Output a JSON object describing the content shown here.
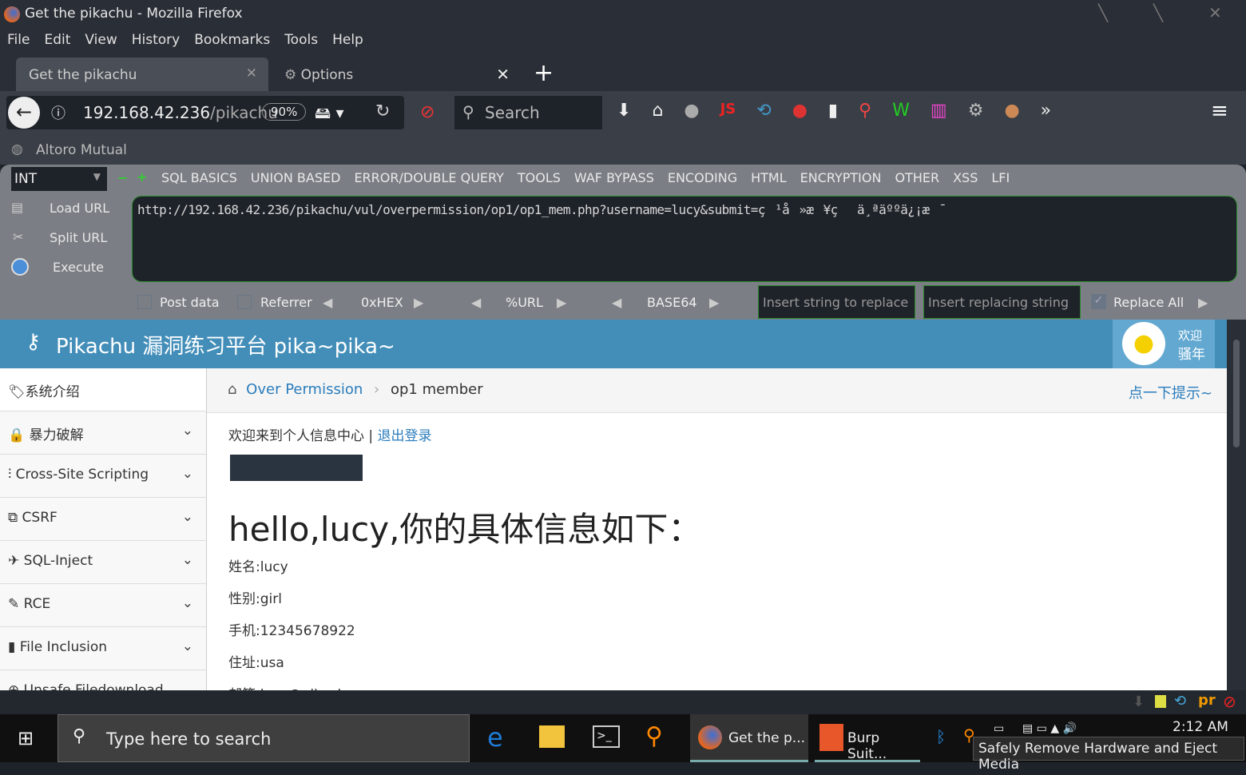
{
  "window": {
    "title": "Get the pikachu - Mozilla Firefox"
  },
  "menu": [
    "File",
    "Edit",
    "View",
    "History",
    "Bookmarks",
    "Tools",
    "Help"
  ],
  "tabs": [
    {
      "label": "Get the pikachu"
    },
    {
      "label": "Options"
    }
  ],
  "navbar": {
    "url_host": "192.168.42.236",
    "url_path": "/pikachu",
    "zoom": "90%",
    "search_placeholder": "Search"
  },
  "bookmarks": [
    {
      "label": "Altoro Mutual"
    }
  ],
  "hackbar": {
    "select": "INT",
    "menus": [
      "SQL BASICS",
      "UNION BASED",
      "ERROR/DOUBLE QUERY",
      "TOOLS",
      "WAF BYPASS",
      "ENCODING",
      "HTML",
      "ENCRYPTION",
      "OTHER",
      "XSS",
      "LFI"
    ],
    "load_url": "Load URL",
    "split_url": "Split URL",
    "execute": "Execute",
    "url_value": "http://192.168.42.236/pikachu/vul/overpermission/op1/op1_mem.php?username=lucy&submit=ç¹å»æ¥çä¸ªäººä¿¡æ¯",
    "post_data": "Post data",
    "referrer": "Referrer",
    "hex": "0xHEX",
    "url_enc": "%URL",
    "base64": "BASE64",
    "replace_placeholder": "Insert string to replace",
    "replacing_placeholder": "Insert replacing string",
    "replace_all": "Replace All"
  },
  "site": {
    "title": "Pikachu 漏洞练习平台 pika~pika~",
    "welcome_1": "欢迎",
    "welcome_2": "骚年",
    "sidebar": [
      {
        "label": "系统介绍",
        "expand": false
      },
      {
        "label": "暴力破解",
        "expand": true
      },
      {
        "label": "Cross-Site Scripting",
        "expand": true
      },
      {
        "label": "CSRF",
        "expand": true
      },
      {
        "label": "SQL-Inject",
        "expand": true
      },
      {
        "label": "RCE",
        "expand": true
      },
      {
        "label": "File Inclusion",
        "expand": true
      },
      {
        "label": "Unsafe Filedownload",
        "expand": true
      }
    ],
    "breadcrumb": {
      "parent": "Over Permission",
      "current": "op1 member",
      "hint": "点一下提示~"
    },
    "greeting": "欢迎来到个人信息中心",
    "separator": "|",
    "logout": "退出登录",
    "heading": "hello,lucy,你的具体信息如下：",
    "fields": [
      "姓名:lucy",
      "性别:girl",
      "手机:12345678922",
      "住址:usa",
      "邮箱:lucy@pikachu.com"
    ]
  },
  "taskbar": {
    "search_placeholder": "Type here to search",
    "apps": [
      {
        "label": "Get the p..."
      },
      {
        "label": "Burp Suit..."
      }
    ],
    "time": "2:12 AM",
    "tooltip": "Safely Remove Hardware and Eject Media"
  },
  "colors": {
    "header": "#438eb9",
    "link": "#2b7dbc",
    "hackbar": "#7b7f85"
  }
}
